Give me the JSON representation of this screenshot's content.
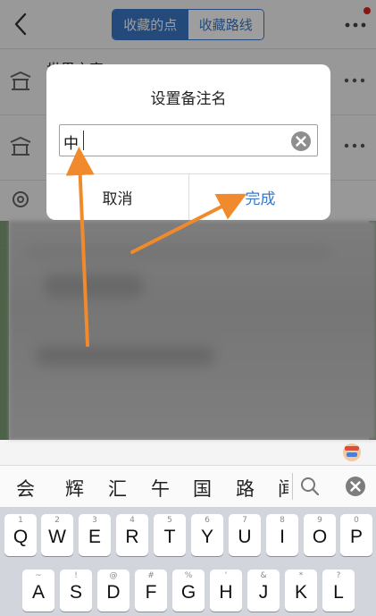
{
  "nav": {
    "tab_points": "收藏的点",
    "tab_routes": "收藏路线",
    "active_color": "#3a78c9"
  },
  "list": {
    "row1_title": "世界之窗"
  },
  "dialog": {
    "title": "设置备注名",
    "input_value": "中",
    "cancel_label": "取消",
    "confirm_label": "完成"
  },
  "keyboard": {
    "candidates": [
      "会",
      "辉",
      "汇",
      "午",
      "国",
      "路",
      "闻"
    ],
    "row1": [
      {
        "num": "1",
        "letter": "Q"
      },
      {
        "num": "2",
        "letter": "W"
      },
      {
        "num": "3",
        "letter": "E"
      },
      {
        "num": "4",
        "letter": "R"
      },
      {
        "num": "5",
        "letter": "T"
      },
      {
        "num": "6",
        "letter": "Y"
      },
      {
        "num": "7",
        "letter": "U"
      },
      {
        "num": "8",
        "letter": "I"
      },
      {
        "num": "9",
        "letter": "O"
      },
      {
        "num": "0",
        "letter": "P"
      }
    ],
    "row2": [
      {
        "num": "~",
        "letter": "A"
      },
      {
        "num": "!",
        "letter": "S"
      },
      {
        "num": "@",
        "letter": "D"
      },
      {
        "num": "#",
        "letter": "F"
      },
      {
        "num": "%",
        "letter": "G"
      },
      {
        "num": "'",
        "letter": "H"
      },
      {
        "num": "&",
        "letter": "J"
      },
      {
        "num": "*",
        "letter": "K"
      },
      {
        "num": "?",
        "letter": "L"
      }
    ]
  },
  "colors": {
    "annotation_arrow": "#f08a2c",
    "badge": "#d22222"
  }
}
